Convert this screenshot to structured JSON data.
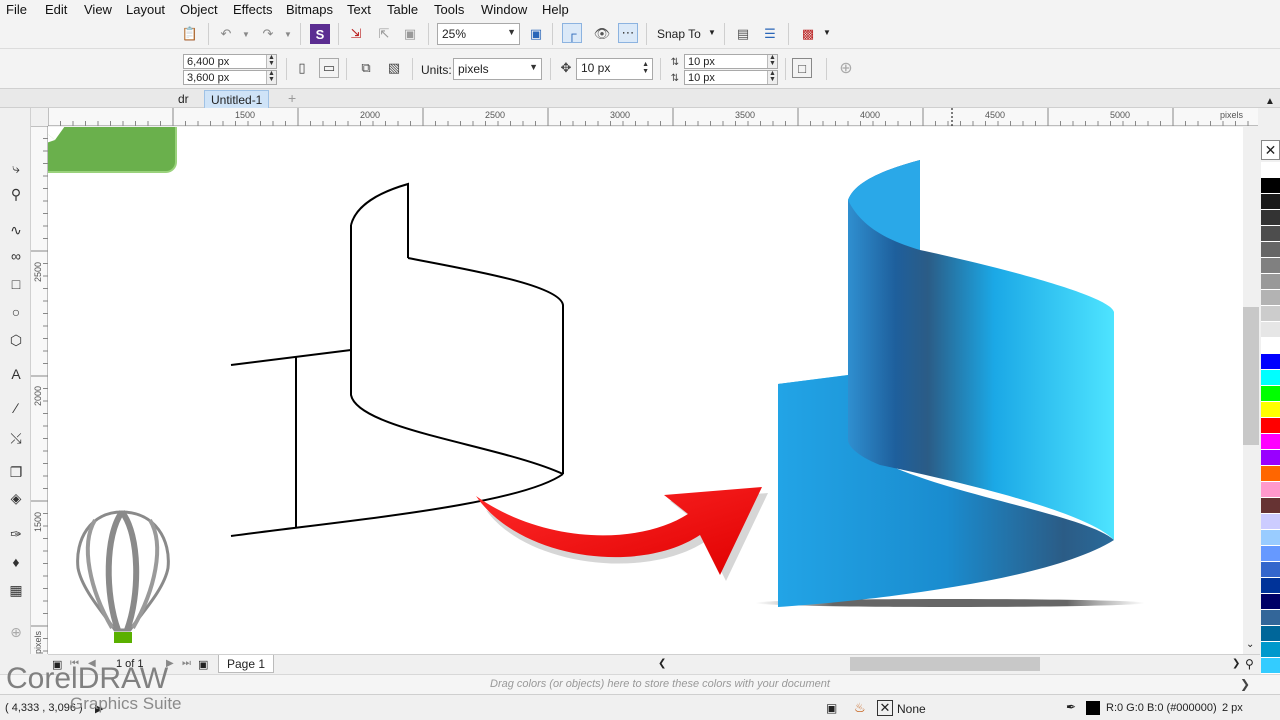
{
  "menu": [
    "File",
    "Edit",
    "View",
    "Layout",
    "Object",
    "Effects",
    "Bitmaps",
    "Text",
    "Table",
    "Tools",
    "Window",
    "Help"
  ],
  "toolbar": {
    "zoom_value": "25%",
    "snap_to_label": "Snap To"
  },
  "property_bar": {
    "width_value": "6,400 px",
    "height_value": "3,600 px",
    "units_label": "Units:",
    "units_value": "pixels",
    "nudge_value": "10 px",
    "dup_x_value": "10 px",
    "dup_y_value": "10 px"
  },
  "tabs": {
    "partial_tab": "dr",
    "active_tab": "Untitled-1"
  },
  "ruler": {
    "h_labels": [
      "1500",
      "2000",
      "2500",
      "3000",
      "3500",
      "4000",
      "4500",
      "5000"
    ],
    "h_unit": "pixels",
    "v_labels": [
      "2500",
      "2000",
      "1500"
    ],
    "v_unit": "pixels"
  },
  "pagebar": {
    "page_count": "1 of 1",
    "page_tab": "Page 1"
  },
  "colordock": {
    "hint": "Drag colors (or objects) here to store these colors with your document"
  },
  "statusbar": {
    "coords": "( 4,333 , 3,096 )",
    "fill_label": "None",
    "outline_color": "R:0 G:0 B:0 (#000000)",
    "outline_width": "2 px"
  },
  "branding": {
    "app_name": "CorelDRAW",
    "suite_name": "Graphics Suite"
  },
  "palette_colors": [
    "#ffffff",
    "#000000",
    "#1a1a1a",
    "#333333",
    "#4d4d4d",
    "#666666",
    "#808080",
    "#999999",
    "#b3b3b3",
    "#cccccc",
    "#e6e6e6",
    "#ffffff",
    "#0000ff",
    "#00ffff",
    "#00ff00",
    "#ffff00",
    "#ff0000",
    "#ff00ff",
    "#9900ff",
    "#ff6600",
    "#ff99cc",
    "#663333",
    "#ccccff",
    "#99ccff",
    "#6699ff",
    "#3366cc",
    "#003399",
    "#000066",
    "#336699",
    "#006699",
    "#0099cc",
    "#33ccff"
  ],
  "colors": {
    "ribbon_light": "#4ee4ff",
    "ribbon_dark": "#2b5c86",
    "arrow_red": "#ff0000",
    "logo_green": "#6ab04c"
  }
}
